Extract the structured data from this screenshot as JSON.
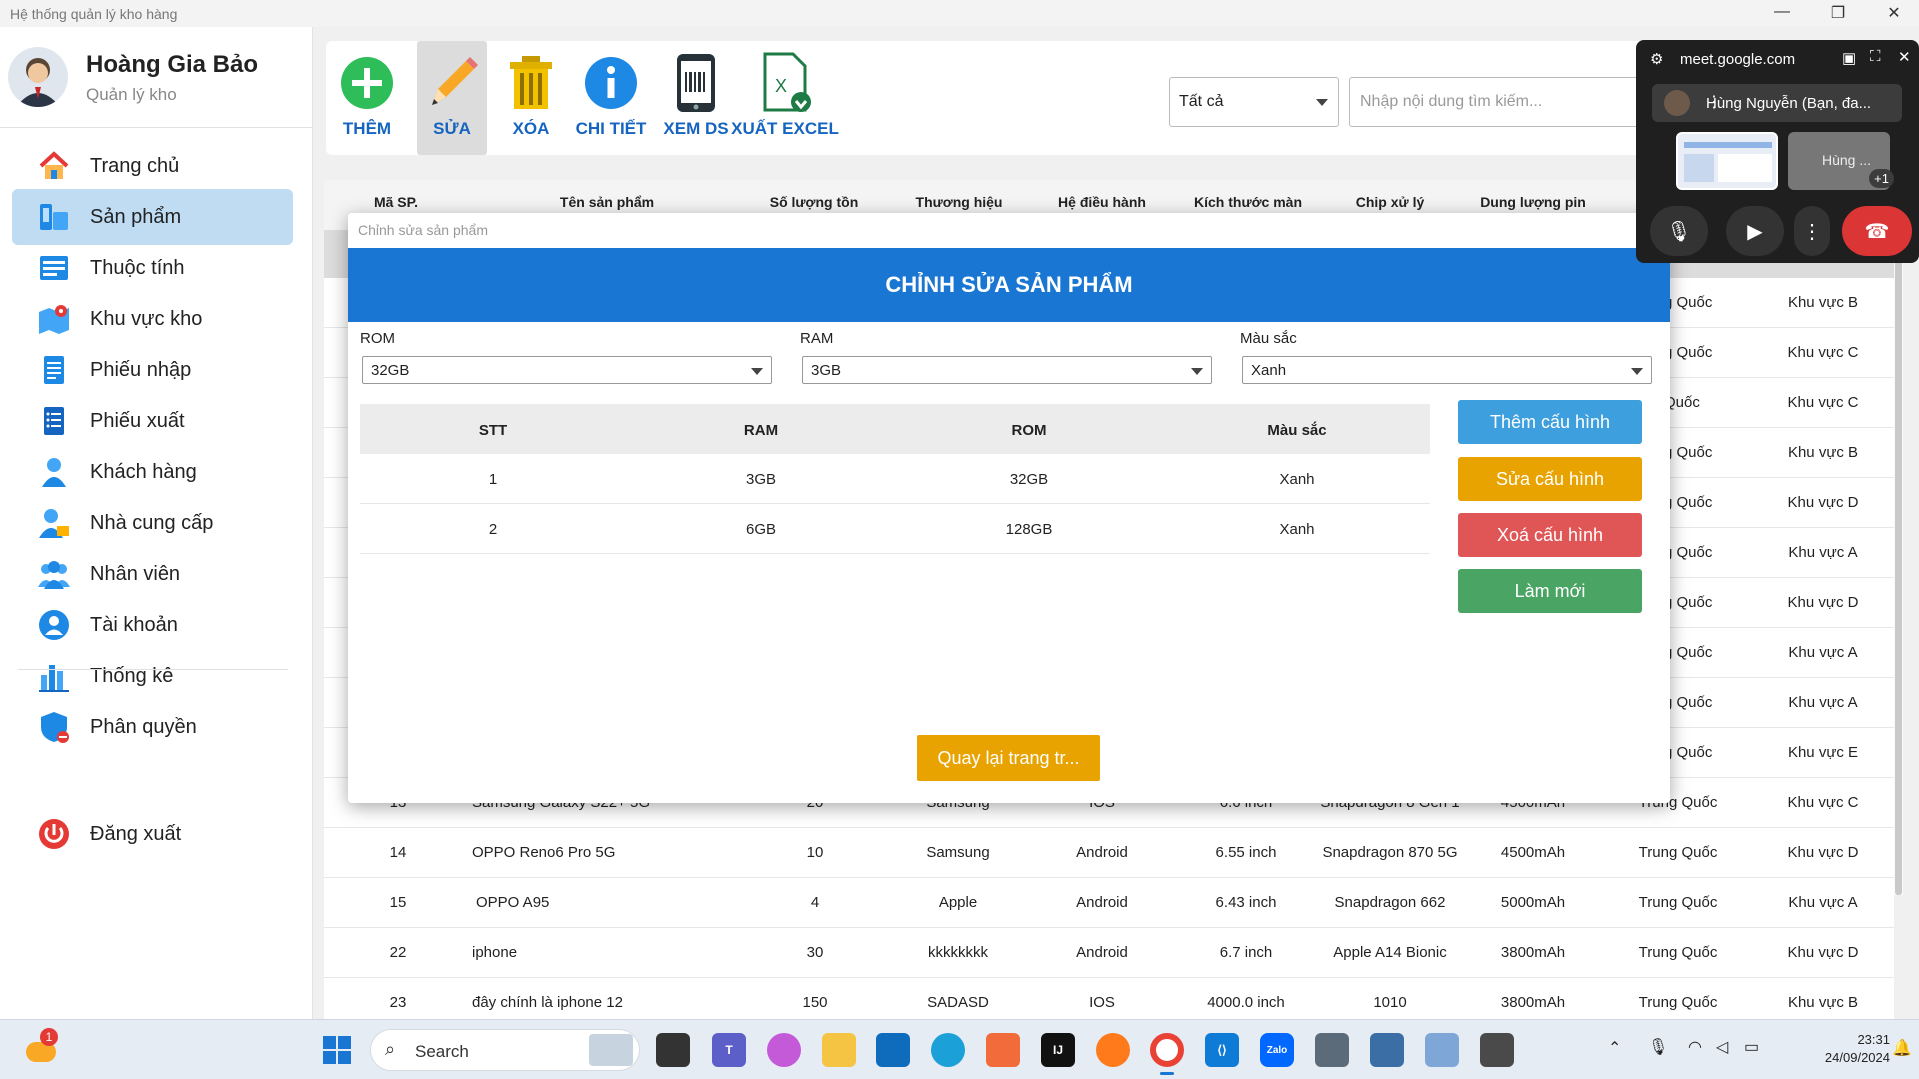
{
  "window": {
    "title": "Hệ thống quản lý kho hàng"
  },
  "user": {
    "name": "Hoàng Gia Bảo",
    "role": "Quản lý kho"
  },
  "sidebar": {
    "items": [
      {
        "label": "Trang chủ",
        "icon": "home-icon"
      },
      {
        "label": "Sản phẩm",
        "icon": "product-icon"
      },
      {
        "label": "Thuộc tính",
        "icon": "attribute-icon"
      },
      {
        "label": "Khu vực kho",
        "icon": "warehouse-location-icon"
      },
      {
        "label": "Phiếu nhập",
        "icon": "import-receipt-icon"
      },
      {
        "label": "Phiếu xuất",
        "icon": "export-receipt-icon"
      },
      {
        "label": "Khách hàng",
        "icon": "customer-icon"
      },
      {
        "label": "Nhà cung cấp",
        "icon": "supplier-icon"
      },
      {
        "label": "Nhân viên",
        "icon": "staff-icon"
      },
      {
        "label": "Tài khoản",
        "icon": "account-icon"
      },
      {
        "label": "Thống kê",
        "icon": "statistics-icon"
      },
      {
        "label": "Phân quyền",
        "icon": "permission-icon"
      }
    ],
    "active_index": 1,
    "logout": "Đăng xuất"
  },
  "toolbar": {
    "add": "THÊM",
    "edit": "SỬA",
    "delete": "XÓA",
    "detail": "CHI TIẾT",
    "view_list": "XEM DS",
    "export_excel": "XUẤT EXCEL"
  },
  "filter": {
    "selected": "Tất cả"
  },
  "search": {
    "placeholder": "Nhập nội dung tìm kiếm..."
  },
  "product_table": {
    "headers": [
      "Mã SP.",
      "Tên sản phẩm",
      "Số lượng tồn",
      "Thương hiệu",
      "Hệ điều hành",
      "Kích thước màn",
      "Chip xử lý",
      "Dung lượng pin"
    ],
    "partial_rows": [
      {
        "origin": "g Quốc",
        "area": "Khu vực B"
      },
      {
        "origin": "g Quốc",
        "area": "Khu vực C"
      },
      {
        "origin": "Quốc",
        "area": "Khu vực C"
      },
      {
        "origin": "g Quốc",
        "area": "Khu vực B"
      },
      {
        "origin": "g Quốc",
        "area": "Khu vực D"
      },
      {
        "origin": "g Quốc",
        "area": "Khu vực A"
      },
      {
        "origin": "g Quốc",
        "area": "Khu vực D"
      },
      {
        "origin": "g Quốc",
        "area": "Khu vực A"
      },
      {
        "origin": "g Quốc",
        "area": "Khu vực A"
      },
      {
        "origin": "g Quốc",
        "area": "Khu vực E"
      }
    ],
    "rows": [
      {
        "id": "13",
        "name": "Samsung Galaxy S22+ 5G",
        "qty": "20",
        "brand": "Samsung",
        "os": "IOS",
        "screen": "6.6 inch",
        "chip": "Snapdragon 8 Gen 1",
        "battery": "4500mAh",
        "origin": "Trung Quốc",
        "area": "Khu vực C"
      },
      {
        "id": "14",
        "name": "OPPO Reno6 Pro 5G",
        "qty": "10",
        "brand": "Samsung",
        "os": "Android",
        "screen": "6.55 inch",
        "chip": "Snapdragon 870 5G",
        "battery": "4500mAh",
        "origin": "Trung Quốc",
        "area": "Khu vực D"
      },
      {
        "id": "15",
        "name": "OPPO A95",
        "qty": "4",
        "brand": "Apple",
        "os": "Android",
        "screen": "6.43 inch",
        "chip": "Snapdragon 662",
        "battery": "5000mAh",
        "origin": "Trung Quốc",
        "area": "Khu vực A"
      },
      {
        "id": "22",
        "name": "iphone",
        "qty": "30",
        "brand": "kkkkkkkk",
        "os": "Android",
        "screen": "6.7 inch",
        "chip": "Apple A14 Bionic",
        "battery": "3800mAh",
        "origin": "Trung Quốc",
        "area": "Khu vực D"
      },
      {
        "id": "23",
        "name": "đây chính là iphone 12",
        "qty": "150",
        "brand": "SADASD",
        "os": "IOS",
        "screen": "4000.0 inch",
        "chip": "1010",
        "battery": "3800mAh",
        "origin": "Trung Quốc",
        "area": "Khu vực B"
      }
    ]
  },
  "dialog": {
    "window_title": "Chỉnh sửa sản phẩm",
    "header": "CHỈNH SỬA SẢN PHẨM",
    "rom": {
      "label": "ROM",
      "value": "32GB"
    },
    "ram": {
      "label": "RAM",
      "value": "3GB"
    },
    "color": {
      "label": "Màu sắc",
      "value": "Xanh"
    },
    "config_table": {
      "headers": [
        "STT",
        "RAM",
        "ROM",
        "Màu sắc"
      ],
      "rows": [
        [
          "1",
          "3GB",
          "32GB",
          "Xanh"
        ],
        [
          "2",
          "6GB",
          "128GB",
          "Xanh"
        ]
      ]
    },
    "buttons": {
      "add": "Thêm cấu hình",
      "edit": "Sửa cấu hình",
      "delete": "Xoá cấu hình",
      "refresh": "Làm mới",
      "back": "Quay lại trang tr..."
    },
    "colors": {
      "header": "#1976d2",
      "add": "#3d9fdd",
      "edit": "#e8a300",
      "delete": "#e05555",
      "refresh": "#4aa564",
      "back": "#e8a300"
    }
  },
  "meet": {
    "url": "meet.google.com",
    "participant": "Hùng Nguyễn (Bạn, đa...",
    "thumb_label": "Hùng ...",
    "extra_count": "+1"
  },
  "taskbar": {
    "search": "Search",
    "time": "23:31",
    "date": "24/09/2024",
    "weather_badge": "1"
  }
}
